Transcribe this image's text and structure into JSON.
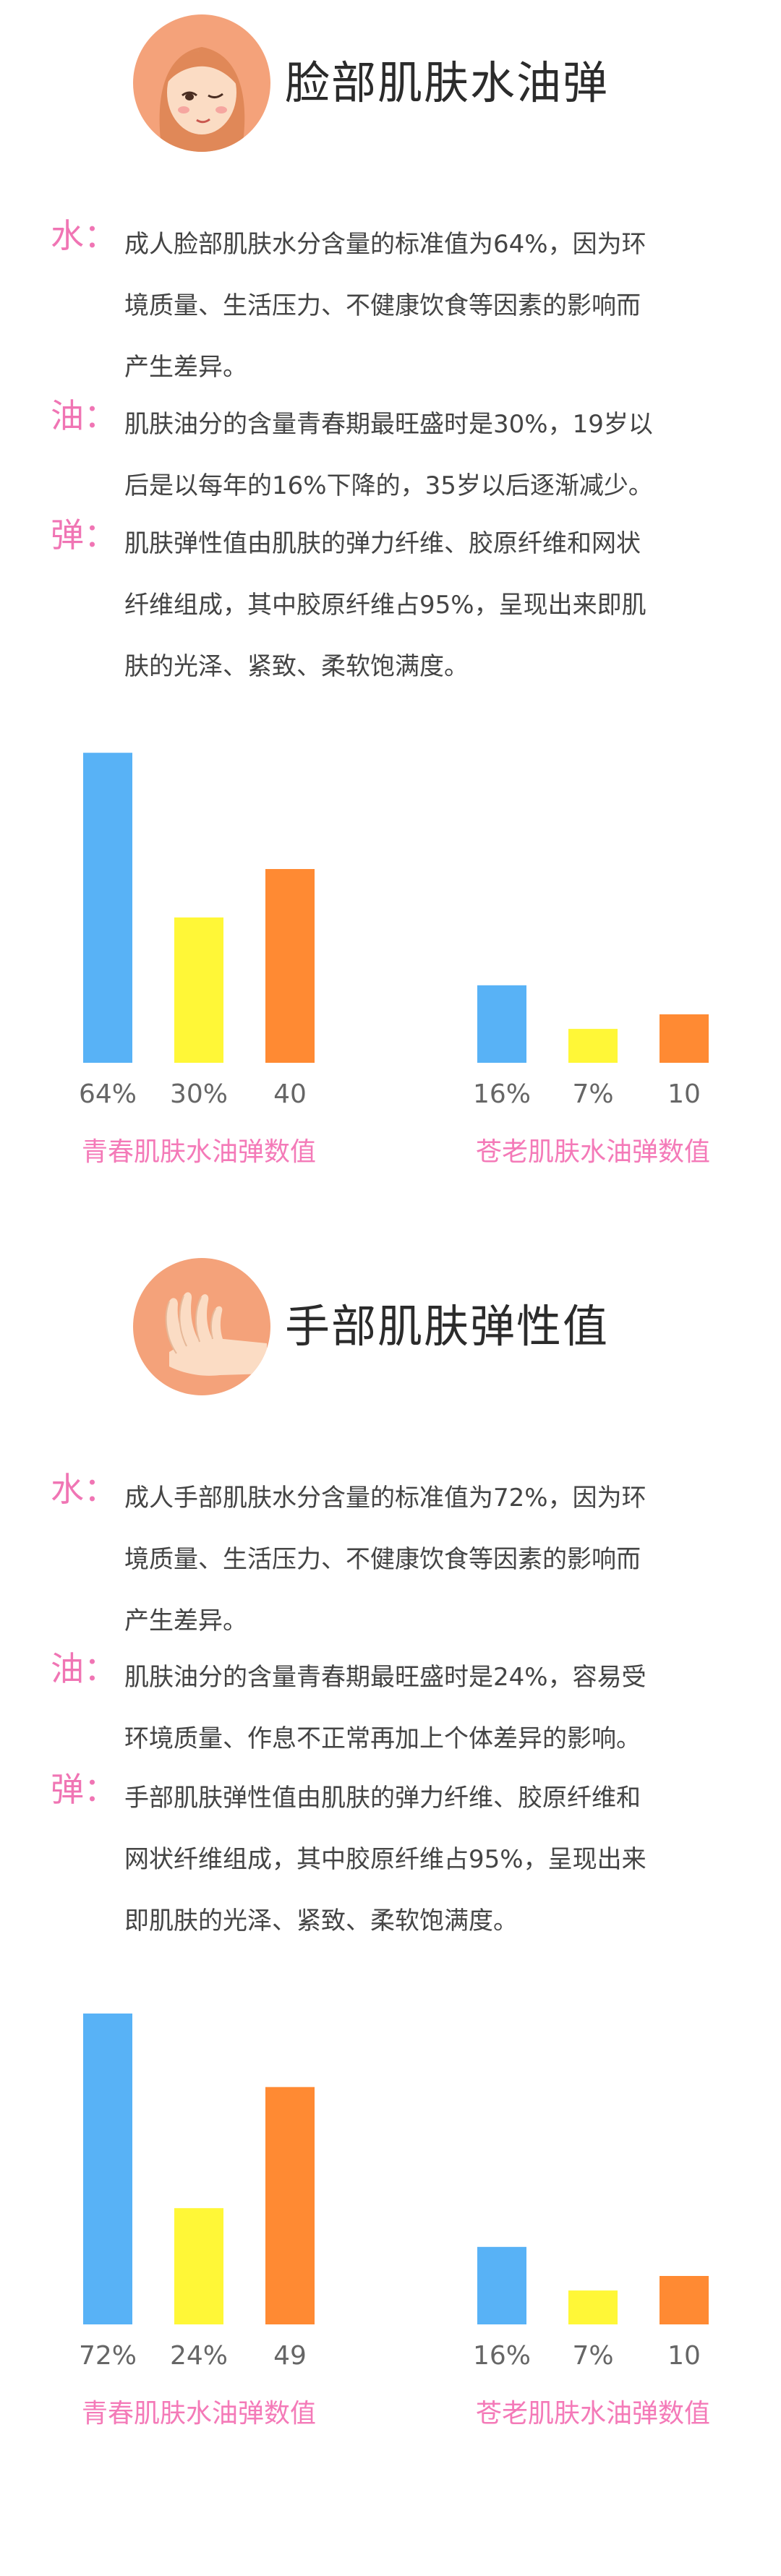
{
  "colors": {
    "blue": "#58b2f6",
    "yellow": "#fff737",
    "orange": "#ff8a33",
    "pink": "#f075b4",
    "avatar_bg": "#f4a27a"
  },
  "sections": [
    {
      "icon": "woman-face-icon",
      "title": "脸部肌肤水油弹",
      "paragraphs": [
        {
          "label": "水：",
          "lines": [
            "成人脸部肌肤水分含量的标准值为64%，因为环",
            "境质量、生活压力、不健康饮食等因素的影响而",
            "产生差异。"
          ]
        },
        {
          "label": "油：",
          "lines": [
            "肌肤油分的含量青春期最旺盛时是30%，19岁以",
            "后是以每年的16%下降的，35岁以后逐渐减少。"
          ]
        },
        {
          "label": "弹：",
          "lines": [
            "肌肤弹性值由肌肤的弹力纤维、胶原纤维和网状",
            "纤维组成，其中胶原纤维占95%，呈现出来即肌",
            "肤的光泽、紧致、柔软饱满度。"
          ]
        }
      ],
      "chart_data": {
        "type": "bar",
        "groups": [
          {
            "caption": "青春肌肤水油弹数值",
            "labels": [
              "64%",
              "30%",
              "40"
            ],
            "values": [
              64,
              30,
              40
            ]
          },
          {
            "caption": "苍老肌肤水油弹数值",
            "labels": [
              "16%",
              "7%",
              "10"
            ],
            "values": [
              16,
              7,
              10
            ]
          }
        ],
        "series_colors": [
          "#58b2f6",
          "#fff737",
          "#ff8a33"
        ]
      }
    },
    {
      "icon": "hand-icon",
      "title": "手部肌肤弹性值",
      "paragraphs": [
        {
          "label": "水：",
          "lines": [
            "成人手部肌肤水分含量的标准值为72%，因为环",
            "境质量、生活压力、不健康饮食等因素的影响而",
            "产生差异。"
          ]
        },
        {
          "label": "油：",
          "lines": [
            "肌肤油分的含量青春期最旺盛时是24%，容易受",
            "环境质量、作息不正常再加上个体差异的影响。"
          ]
        },
        {
          "label": "弹：",
          "lines": [
            "手部肌肤弹性值由肌肤的弹力纤维、胶原纤维和",
            "网状纤维组成，其中胶原纤维占95%，呈现出来",
            "即肌肤的光泽、紧致、柔软饱满度。"
          ]
        }
      ],
      "chart_data": {
        "type": "bar",
        "groups": [
          {
            "caption": "青春肌肤水油弹数值",
            "labels": [
              "72%",
              "24%",
              "49"
            ],
            "values": [
              72,
              24,
              49
            ]
          },
          {
            "caption": "苍老肌肤水油弹数值",
            "labels": [
              "16%",
              "7%",
              "10"
            ],
            "values": [
              16,
              7,
              10
            ]
          }
        ],
        "series_colors": [
          "#58b2f6",
          "#fff737",
          "#ff8a33"
        ]
      }
    }
  ]
}
